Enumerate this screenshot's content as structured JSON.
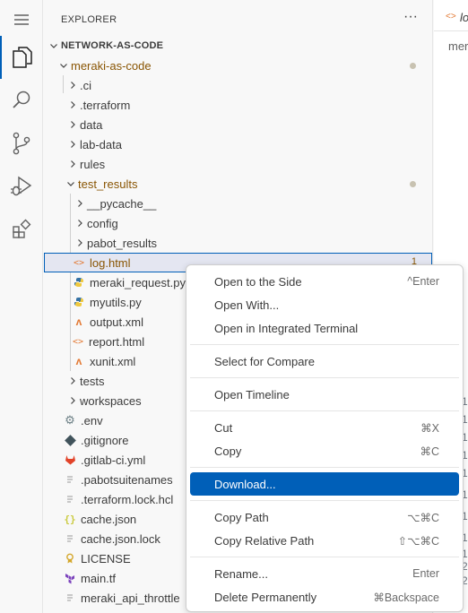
{
  "activity_bar": {
    "icons": [
      "menu-icon",
      "files-icon",
      "search-icon",
      "source-control-icon",
      "run-debug-icon",
      "extensions-icon"
    ]
  },
  "explorer": {
    "header": "EXPLORER",
    "more_actions": "···",
    "root": "NETWORK-AS-CODE",
    "items": {
      "meraki_as_code": "meraki-as-code",
      "ci": ".ci",
      "terraform": ".terraform",
      "data": "data",
      "lab_data": "lab-data",
      "rules": "rules",
      "test_results": "test_results",
      "pycache": "__pycache__",
      "config": "config",
      "pabot_results": "pabot_results",
      "log_html": "log.html",
      "log_html_badge": "1",
      "meraki_request": "meraki_request.py",
      "myutils": "myutils.py",
      "output_xml": "output.xml",
      "report_html": "report.html",
      "xunit_xml": "xunit.xml",
      "tests": "tests",
      "workspaces": "workspaces",
      "env": ".env",
      "gitignore": ".gitignore",
      "gitlab_ci": ".gitlab-ci.yml",
      "pabotsuitenames": ".pabotsuitenames",
      "terraform_lock": ".terraform.lock.hcl",
      "cache_json": "cache.json",
      "cache_json_lock": "cache.json.lock",
      "license": "LICENSE",
      "main_tf": "main.tf",
      "meraki_api_throttle": "meraki_api_throttle"
    }
  },
  "editor": {
    "tab_label": "lo",
    "text": "meri",
    "line_numbers": [
      "1",
      "1",
      "1",
      "1",
      "1",
      "1",
      "1",
      "1",
      "1",
      "2",
      "2"
    ]
  },
  "context_menu": {
    "open_to_side": "Open to the Side",
    "open_to_side_key": "^Enter",
    "open_with": "Open With...",
    "open_terminal": "Open in Integrated Terminal",
    "select_compare": "Select for Compare",
    "open_timeline": "Open Timeline",
    "cut": "Cut",
    "cut_key": "⌘X",
    "copy": "Copy",
    "copy_key": "⌘C",
    "download": "Download...",
    "copy_path": "Copy Path",
    "copy_path_key": "⌥⌘C",
    "copy_relative_path": "Copy Relative Path",
    "copy_relative_path_key": "⇧⌥⌘C",
    "rename": "Rename...",
    "rename_key": "Enter",
    "delete_permanently": "Delete Permanently",
    "delete_key": "⌘Backspace"
  },
  "colors": {
    "accent": "#005fb8",
    "modified_text": "#895503",
    "html_icon": "#e37933",
    "python_icon": "#3572a5",
    "json_icon": "#cbcb41",
    "terraform_icon": "#7b42bc",
    "license_icon": "#d4a72c",
    "gitlab_icon": "#e24329"
  }
}
